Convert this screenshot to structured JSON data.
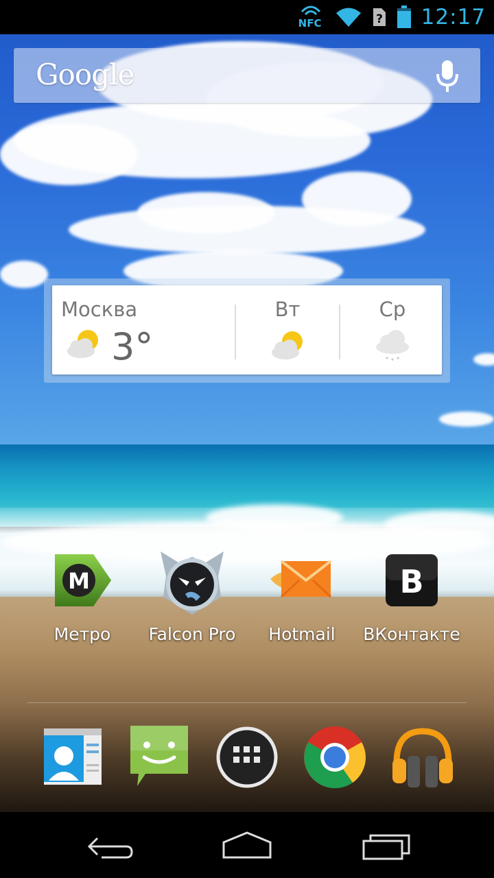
{
  "status_bar": {
    "nfc_label": "NFC",
    "time": "12:17",
    "icons": [
      "nfc-icon",
      "wifi-icon",
      "sim-unknown-icon",
      "battery-icon"
    ],
    "accent_color": "#33b5e5"
  },
  "search": {
    "logo_text": "Google",
    "mic_icon": "mic-icon"
  },
  "weather": {
    "city": "Москва",
    "temperature": "3°",
    "current_icon": "partly-cloudy-icon",
    "forecast": [
      {
        "day": "Вт",
        "icon": "partly-cloudy-icon"
      },
      {
        "day": "Ср",
        "icon": "rain-cloud-icon"
      }
    ]
  },
  "apps": [
    {
      "label": "Метро",
      "icon": "metro-icon"
    },
    {
      "label": "Falcon Pro",
      "icon": "falcon-pro-icon"
    },
    {
      "label": "Hotmail",
      "icon": "hotmail-icon"
    },
    {
      "label": "ВКонтакте",
      "icon": "vkontakte-icon"
    }
  ],
  "dock": [
    {
      "icon": "contacts-icon"
    },
    {
      "icon": "messaging-icon"
    },
    {
      "icon": "app-drawer-icon"
    },
    {
      "icon": "chrome-icon"
    },
    {
      "icon": "play-music-icon"
    }
  ],
  "nav": [
    "back-icon",
    "home-icon",
    "recent-apps-icon"
  ]
}
